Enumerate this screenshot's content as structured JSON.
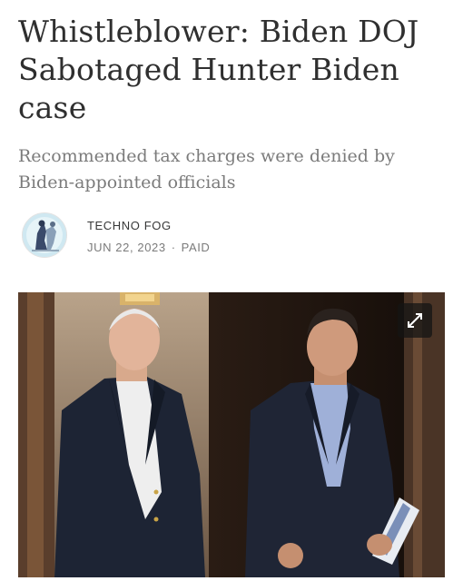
{
  "article": {
    "title": "Whistleblower: Biden DOJ Sabotaged Hunter Biden case",
    "subtitle": "Recommended tax charges were denied by Biden-appointed officials"
  },
  "byline": {
    "author": "TECHNO FOG",
    "date": "JUN 22, 2023",
    "separator": "·",
    "access": "PAID"
  },
  "photo": {
    "expand_icon": "expand-icon"
  }
}
